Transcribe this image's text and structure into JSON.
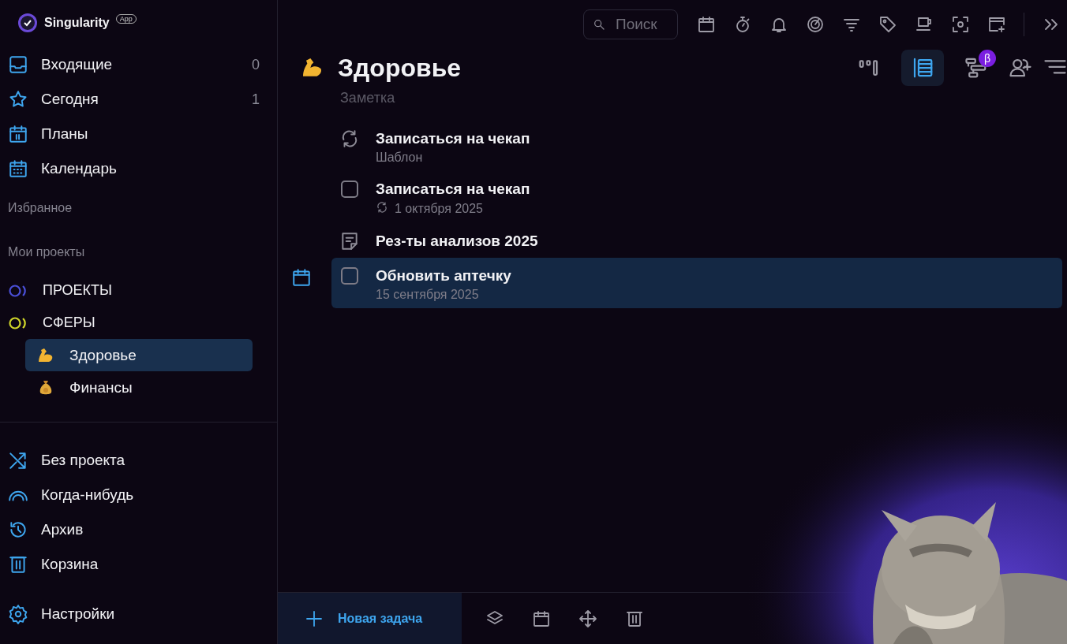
{
  "app": {
    "name": "Singularity",
    "badge": "App"
  },
  "sidebar": {
    "nav": [
      {
        "label": "Входящие",
        "count": "0"
      },
      {
        "label": "Сегодня",
        "count": "1"
      },
      {
        "label": "Планы"
      },
      {
        "label": "Календарь"
      }
    ],
    "favorites_label": "Избранное",
    "projects_label": "Мои проекты",
    "projects": [
      {
        "label": "ПРОЕКТЫ",
        "color": "#4a4fd6"
      },
      {
        "label": "СФЕРЫ",
        "color": "#cfd52a",
        "children": [
          {
            "label": "Здоровье",
            "selected": true
          },
          {
            "label": "Финансы",
            "selected": false
          }
        ]
      }
    ],
    "bottom_nav": [
      {
        "label": "Без проекта"
      },
      {
        "label": "Когда-нибудь"
      },
      {
        "label": "Архив"
      },
      {
        "label": "Корзина"
      }
    ],
    "settings": "Настройки"
  },
  "toolbar": {
    "search": {
      "placeholder": "Поиск"
    }
  },
  "views": [
    {
      "selected": false
    },
    {
      "selected": true
    },
    {
      "selected": false,
      "badge": "β"
    }
  ],
  "project": {
    "title": "Здоровье",
    "note_placeholder": "Заметка"
  },
  "tasks": [
    {
      "kind": "template",
      "title": "Записаться на чекап",
      "subtitle": "Шаблон",
      "selected": false
    },
    {
      "kind": "task",
      "title": "Записаться на чекап",
      "date": "1 октября 2025",
      "repeat": true,
      "checked": false,
      "selected": false
    },
    {
      "kind": "note",
      "title": "Рез-ты анализов 2025",
      "selected": false
    },
    {
      "kind": "task",
      "title": "Обновить аптечку",
      "date": "15 сентября 2025",
      "repeat": false,
      "checked": false,
      "selected": true
    }
  ],
  "bottom_bar": {
    "new_task": "Новая задача"
  }
}
